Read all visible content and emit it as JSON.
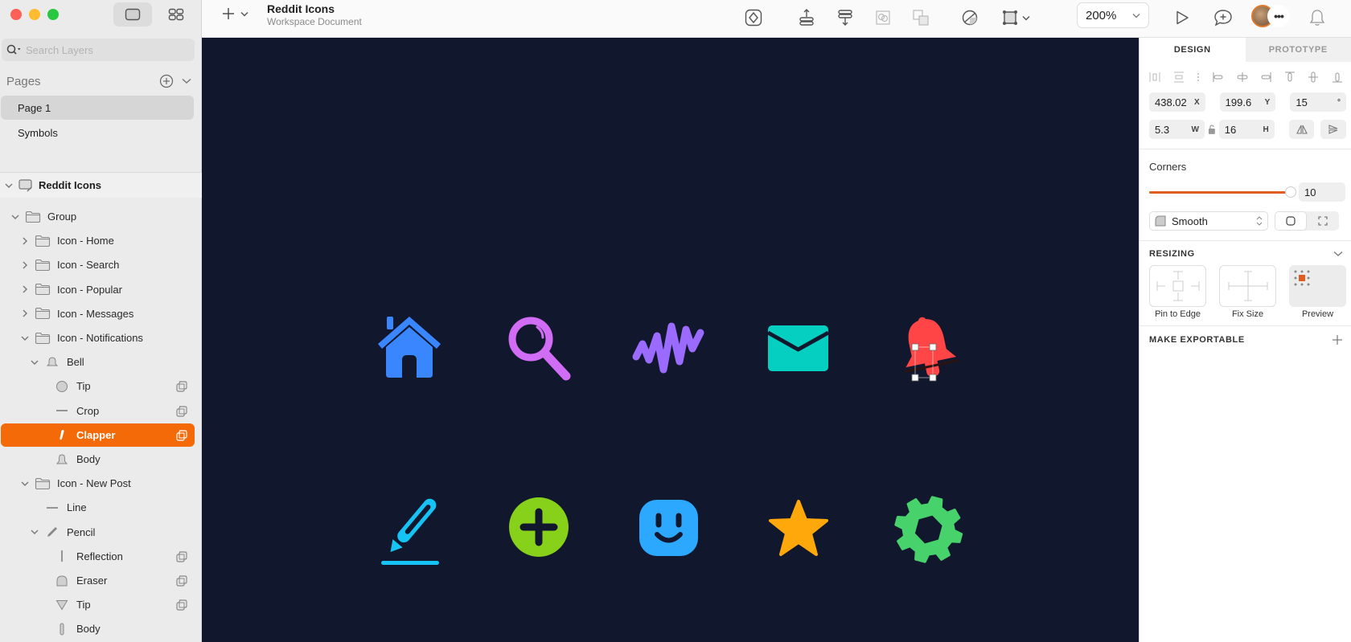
{
  "window": {
    "traffic_lights": [
      "close",
      "minimize",
      "zoom"
    ],
    "view_toggle": [
      "canvas-view-icon",
      "components-grid-icon"
    ]
  },
  "sidebar": {
    "search_placeholder": "Search Layers",
    "pages_title": "Pages",
    "pages": [
      {
        "label": "Page 1",
        "active": true
      },
      {
        "label": "Symbols",
        "active": false
      }
    ],
    "document_label": "Reddit Icons",
    "layers": [
      {
        "label": "Group",
        "depth": 0,
        "chevron": "down",
        "icon": "folder-icon",
        "mask": false,
        "selected": false
      },
      {
        "label": "Icon - Home",
        "depth": 1,
        "chevron": "right",
        "icon": "folder-icon",
        "mask": false,
        "selected": false
      },
      {
        "label": "Icon - Search",
        "depth": 1,
        "chevron": "right",
        "icon": "folder-icon",
        "mask": false,
        "selected": false
      },
      {
        "label": "Icon - Popular",
        "depth": 1,
        "chevron": "right",
        "icon": "folder-icon",
        "mask": false,
        "selected": false
      },
      {
        "label": "Icon - Messages",
        "depth": 1,
        "chevron": "right",
        "icon": "folder-icon",
        "mask": false,
        "selected": false
      },
      {
        "label": "Icon - Notifications",
        "depth": 1,
        "chevron": "down",
        "icon": "folder-icon",
        "mask": false,
        "selected": false
      },
      {
        "label": "Bell",
        "depth": 2,
        "chevron": "down",
        "icon": "bell-icon",
        "mask": false,
        "selected": false
      },
      {
        "label": "Tip",
        "depth": 3,
        "chevron": "",
        "icon": "circle-shape-icon",
        "mask": true,
        "selected": false
      },
      {
        "label": "Crop",
        "depth": 3,
        "chevron": "",
        "icon": "line-shape-icon",
        "mask": true,
        "selected": false
      },
      {
        "label": "Clapper",
        "depth": 3,
        "chevron": "",
        "icon": "clapper-shape-icon",
        "mask": true,
        "selected": true
      },
      {
        "label": "Body",
        "depth": 3,
        "chevron": "",
        "icon": "bell-body-icon",
        "mask": false,
        "selected": false
      },
      {
        "label": "Icon - New Post",
        "depth": 1,
        "chevron": "down",
        "icon": "folder-icon",
        "mask": false,
        "selected": false
      },
      {
        "label": "Line",
        "depth": 2,
        "chevron": "",
        "icon": "line-shape-icon",
        "mask": false,
        "selected": false
      },
      {
        "label": "Pencil",
        "depth": 2,
        "chevron": "down",
        "icon": "pencil-icon",
        "mask": false,
        "selected": false
      },
      {
        "label": "Reflection",
        "depth": 3,
        "chevron": "",
        "icon": "vertical-line-icon",
        "mask": true,
        "selected": false
      },
      {
        "label": "Eraser",
        "depth": 3,
        "chevron": "",
        "icon": "eraser-shape-icon",
        "mask": true,
        "selected": false
      },
      {
        "label": "Tip",
        "depth": 3,
        "chevron": "",
        "icon": "triangle-shape-icon",
        "mask": true,
        "selected": false
      },
      {
        "label": "Body",
        "depth": 3,
        "chevron": "",
        "icon": "rect-shape-icon",
        "mask": false,
        "selected": false
      }
    ]
  },
  "toolbar": {
    "document_title": "Reddit Icons",
    "document_subtitle": "Workspace Document",
    "zoom_level": "200%",
    "icons": [
      "create-symbol-icon",
      "forward-icon",
      "backward-icon",
      "mask-icon",
      "combine-icon",
      "scissors-icon",
      "resize-icon",
      "play-icon",
      "comment-add-icon",
      "more-icon",
      "notifications-bell-icon"
    ]
  },
  "canvas": {
    "background": "#11182d",
    "icons": [
      {
        "name": "home",
        "color": "#3a86ff"
      },
      {
        "name": "search",
        "color": "#d16cf5"
      },
      {
        "name": "popular",
        "color": "#9b6bff"
      },
      {
        "name": "messages",
        "color": "#05cfc0"
      },
      {
        "name": "notifications",
        "color": "#ff4545"
      },
      {
        "name": "new-post",
        "color": "#15c3f5"
      },
      {
        "name": "add",
        "color": "#87d11a"
      },
      {
        "name": "profile",
        "color": "#2da8ff"
      },
      {
        "name": "favorite",
        "color": "#ffa80c"
      },
      {
        "name": "settings",
        "color": "#48d26c"
      }
    ]
  },
  "inspector": {
    "tabs": [
      {
        "label": "DESIGN",
        "active": true
      },
      {
        "label": "PROTOTYPE",
        "active": false
      }
    ],
    "x": {
      "value": "438.02",
      "label": "X"
    },
    "y": {
      "value": "199.6",
      "label": "Y"
    },
    "rotation": {
      "value": "15",
      "label": "°"
    },
    "width": {
      "value": "5.3",
      "label": "W"
    },
    "height": {
      "value": "16",
      "label": "H"
    },
    "corners_label": "Corners",
    "corner_radius": "10",
    "corner_slider_fraction": 1.0,
    "corner_style": "Smooth",
    "resizing_label": "RESIZING",
    "resizing_options": [
      {
        "label": "Pin to Edge"
      },
      {
        "label": "Fix Size"
      },
      {
        "label": "Preview"
      }
    ],
    "export_label": "MAKE EXPORTABLE",
    "accent": "#e05d22"
  }
}
